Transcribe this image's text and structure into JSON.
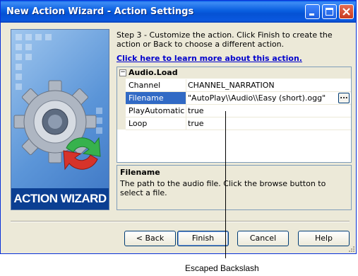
{
  "window": {
    "title": "New Action Wizard - Action Settings"
  },
  "sidebar": {
    "banner_label": "ACTION WIZARD"
  },
  "main": {
    "instructions": "Step 3 - Customize the action.  Click Finish to create the action or Back to choose a different action.",
    "learn_more_link": "Click here to learn more about this action."
  },
  "property_grid": {
    "category": "Audio.Load",
    "properties": [
      {
        "name": "Channel",
        "value": "CHANNEL_NARRATION"
      },
      {
        "name": "Filename",
        "value": "\"AutoPlay\\\\Audio\\\\Easy (short).ogg\"",
        "browse": "..."
      },
      {
        "name": "PlayAutomatic",
        "value": "true"
      },
      {
        "name": "Loop",
        "value": "true"
      }
    ]
  },
  "description": {
    "title": "Filename",
    "text": "The path to the audio file. Click the browse button to select a file."
  },
  "buttons": {
    "back": "< Back",
    "finish": "Finish",
    "cancel": "Cancel",
    "help": "Help"
  },
  "annotation": {
    "label": "Escaped Backslash"
  },
  "colors": {
    "titlebar": "#0a5ee8",
    "selection": "#316ac5",
    "link": "#0000cc"
  }
}
